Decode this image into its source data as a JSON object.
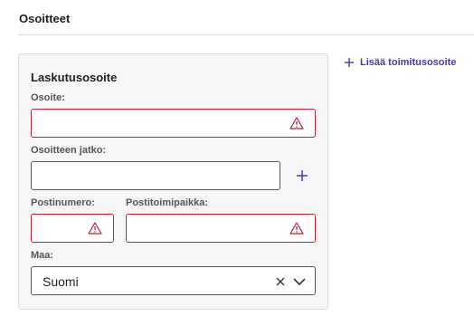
{
  "section": {
    "title": "Osoitteet"
  },
  "add_delivery_link": {
    "label": "Lisää toimitusosoite"
  },
  "billing": {
    "title": "Laskutusosoite",
    "address": {
      "label": "Osoite:",
      "value": ""
    },
    "address_cont": {
      "label": "Osoitteen jatko:",
      "value": ""
    },
    "postal_code": {
      "label": "Postinumero:",
      "value": ""
    },
    "city": {
      "label": "Postitoimipaikka:",
      "value": ""
    },
    "country": {
      "label": "Maa:",
      "value": "Suomi"
    }
  },
  "colors": {
    "error": "#b3263e",
    "accent": "#4a3aa8"
  }
}
